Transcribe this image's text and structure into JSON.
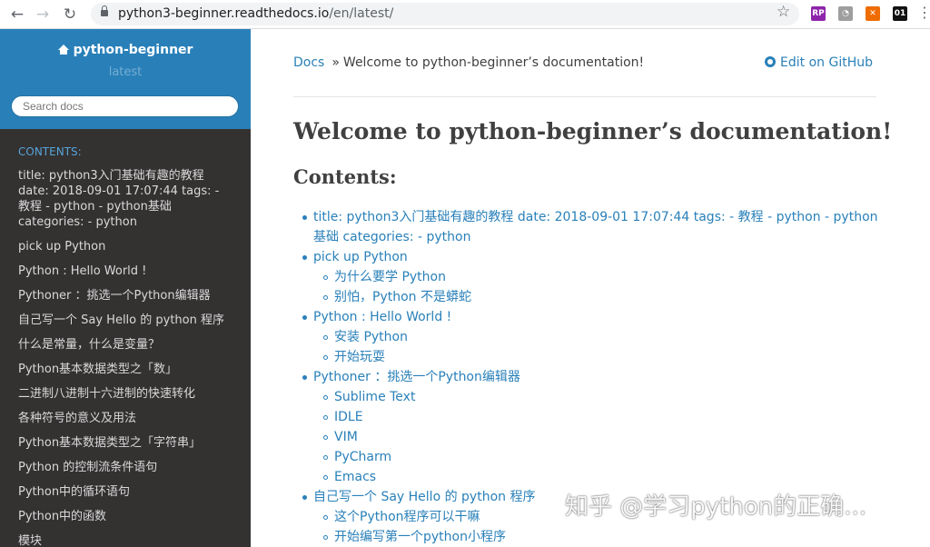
{
  "browser": {
    "url_host": "python3-beginner.readthedocs.io",
    "url_path": "/en/latest/",
    "back_icon": "←",
    "forward_icon": "→",
    "reload_icon": "↻",
    "star_icon": "☆",
    "extensions": [
      {
        "name": "rp-extension",
        "label": "RP",
        "color": "#8e24aa"
      },
      {
        "name": "ghost-extension",
        "label": "◔",
        "color": "#9e9e9e"
      },
      {
        "name": "orange-extension",
        "label": "✕",
        "color": "#ef6c00"
      },
      {
        "name": "01-extension",
        "label": "01",
        "color": "#111111"
      }
    ]
  },
  "sidebar": {
    "project_name": "python-beginner",
    "version": "latest",
    "search_placeholder": "Search docs",
    "caption": "CONTENTS:",
    "items": [
      "title: python3入门基础有趣的教程 date: 2018-09-01 17:07:44 tags: - 教程 - python - python基础 categories: - python",
      "pick up Python",
      "Python : Hello World !",
      "Pythoner ：挑选一个Python编辑器",
      "自己写一个 Say Hello 的 python 程序",
      "什么是常量，什么是变量？",
      "Python基本数据类型之「数」",
      "二进制八进制十六进制的快速转化",
      "各种符号的意义及用法",
      "Python基本数据类型之「字符串」",
      "Python 的控制流条件语句",
      "Python中的循环语句",
      "Python中的函数",
      "模块"
    ]
  },
  "content": {
    "breadcrumb_home": "Docs",
    "breadcrumb_separator": "»",
    "breadcrumb_current": "Welcome to python-beginner’s documentation!",
    "edit_link": "Edit on GitHub",
    "title": "Welcome to python-beginner’s documentation!",
    "contents_heading": "Contents:",
    "toc": [
      {
        "label": "title: python3入门基础有趣的教程 date: 2018-09-01 17:07:44 tags: - 教程 - python - python基础 categories: - python",
        "children": []
      },
      {
        "label": "pick up Python",
        "children": [
          "为什么要学 Python",
          "别怕，Python 不是蟒蛇"
        ]
      },
      {
        "label": "Python : Hello World !",
        "children": [
          "安装 Python",
          "开始玩耍"
        ]
      },
      {
        "label": "Pythoner ：挑选一个Python编辑器",
        "children": [
          "Sublime Text",
          "IDLE",
          "VIM",
          "PyCharm",
          "Emacs"
        ]
      },
      {
        "label": "自己写一个 Say Hello 的 python 程序",
        "children": [
          "这个Python程序可以干嘛",
          "开始编写第一个python小程序"
        ]
      }
    ]
  },
  "watermark": "知乎 @学习python的正确..."
}
